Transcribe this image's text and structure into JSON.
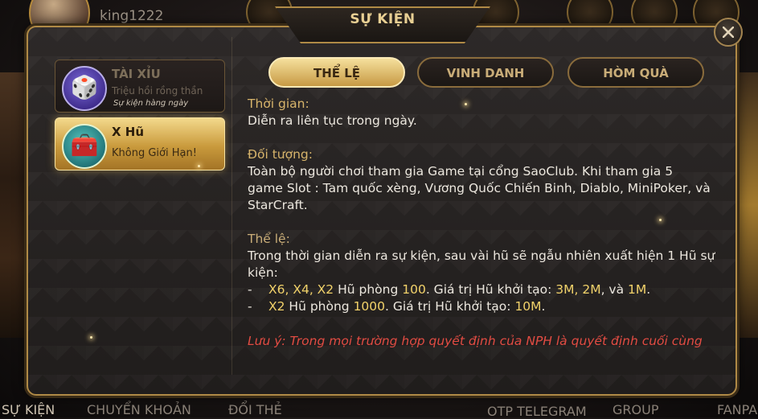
{
  "background": {
    "username": "king1222",
    "bottom_tabs": [
      "SỰ KIỆN",
      "CHUYỂN KHOẢN",
      "ĐỔI THẺ",
      "OTP TELEGRAM",
      "GROUP",
      "FANPA"
    ]
  },
  "modal": {
    "title": "SỰ KIỆN",
    "events": [
      {
        "name": "TÀI XỈU",
        "subtitle": "Triệu hồi rồng thần",
        "subtitle2": "Sự kiện hàng ngày",
        "icon": "dice-icon"
      },
      {
        "name": "X Hũ",
        "subtitle": "Không Giới Hạn!",
        "icon": "treasure-chest-icon"
      }
    ],
    "tabs": [
      "THỂ LỆ",
      "VINH DANH",
      "HÒM QUÀ"
    ],
    "selected_tab": "THỂ LỆ",
    "content": {
      "time_label": "Thời gian:",
      "time_text": "Diễn ra liên tục trong ngày.",
      "target_label": "Đối tượng:",
      "target_lines": [
        "Toàn bộ người chơi tham gia Game tại cổng SaoClub. Khi tham gia 5",
        "game Slot : Tam quốc xèng, Vương Quốc Chiến Binh, Diablo, MiniPoker, và",
        "StarCraft."
      ],
      "rules_label": "Thể lệ:",
      "rules_lines": [
        "Trong thời gian diễn ra sự kiện, sau vài hũ sẽ ngẫu nhiên xuất hiện 1 Hũ sự",
        "kiện:"
      ],
      "bullet_mark": "-",
      "bullet1": {
        "multipliers": "X6, X4, X2",
        "text_a": " Hũ phòng ",
        "room": "100",
        "text_b": ". Giá trị Hũ khởi tạo: ",
        "values": "3M, 2M",
        "text_c": ", và ",
        "value_last": "1M",
        "text_d": "."
      },
      "bullet2": {
        "multipliers": "X2",
        "text_a": " Hũ phòng ",
        "room": "1000",
        "text_b": ". Giá trị Hũ khởi tạo: ",
        "values": "10M",
        "text_c": "."
      },
      "note": "Lưu ý:  Trong mọi trường hợp quyết định của NPH là quyết định cuối cùng"
    }
  },
  "colors": {
    "gold": "#d7b46b",
    "highlight": "#f2d26a",
    "note_red": "#e24c43"
  }
}
